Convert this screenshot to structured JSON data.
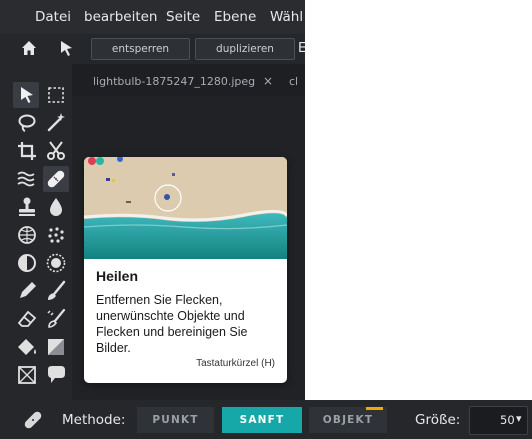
{
  "menubar": {
    "items": [
      "Datei",
      "bearbeiten",
      "Seite",
      "Ebene",
      "Wähl"
    ]
  },
  "toolbar": {
    "unlock_label": "entsperren",
    "duplicate_label": "duplizieren",
    "overflow_letter": "E"
  },
  "tabs": [
    {
      "label": "lightbulb-1875247_1280.jpeg",
      "close": "×"
    },
    {
      "label": "cl",
      "close": ""
    }
  ],
  "tools": [
    "pointer-tool-icon",
    "marquee-select-icon",
    "lasso-icon",
    "magic-wand-icon",
    "crop-icon",
    "cut-icon",
    "liquify-icon",
    "heal-bandage-icon",
    "stamp-icon",
    "drop-blur-icon",
    "sponge-icon",
    "dots-pattern-icon",
    "dodge-burn-icon",
    "sharpen-sun-icon",
    "pen-icon",
    "brush-icon",
    "eraser-icon",
    "color-replace-icon",
    "paint-bucket-icon",
    "gradient-square-icon",
    "frame-icon",
    "speech-bubble-icon"
  ],
  "tooltip": {
    "title": "Heilen",
    "description": "Entfernen Sie Flecken, unerwünschte Objekte und Flecken und bereinigen Sie Bilder.",
    "shortcut": "Tastaturkürzel (H)"
  },
  "options": {
    "method_label": "Methode:",
    "methods": [
      {
        "label": "PUNKT",
        "active": false
      },
      {
        "label": "SANFT",
        "active": true
      },
      {
        "label": "OBJEKT",
        "active": false
      }
    ],
    "size_label": "Größe:",
    "size_value": "50",
    "size_caret": "▾"
  },
  "colors": {
    "accent": "#16a8a8",
    "object_indicator": "#f2a900"
  }
}
